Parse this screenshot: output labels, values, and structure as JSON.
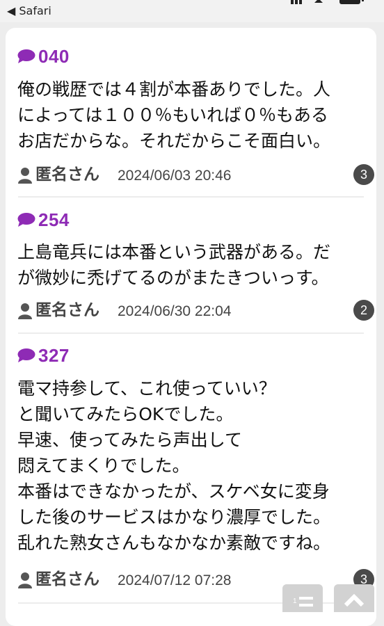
{
  "status_bar": {
    "back_label": "◀ Safari"
  },
  "posts": [
    {
      "number": "040",
      "body": "俺の戦歴では４割が本番ありでした。人\nによっては１００％もいれば０％もある\nお店だからな。それだからこそ面白い。",
      "author": "匿名さん",
      "date": "2024/06/03 20:46",
      "replies": "3"
    },
    {
      "number": "254",
      "body": "上島竜兵には本番という武器がある。だ\nが微妙に禿げてるのがまたきついっす。",
      "author": "匿名さん",
      "date": "2024/06/30 22:04",
      "replies": "2"
    },
    {
      "number": "327",
      "body": "電マ持参して、これ使っていい？\nと聞いてみたらOKでした。\n早速、使ってみたら声出して\n悶えてまくりでした。\n本番はできなかったが、スケベ女に変身\nした後のサービスはかなり濃厚でした。\n乱れた熟女さんもなかなか素敵ですね。",
      "author": "匿名さん",
      "date": "2024/07/12 07:28",
      "replies": "3"
    }
  ],
  "colors": {
    "accent": "#8e2bb5",
    "badge": "#4a4a4a",
    "background": "#ededed"
  },
  "icons": [
    "comment-bubble-icon",
    "person-icon",
    "list-icon",
    "chevron-up-icon"
  ]
}
